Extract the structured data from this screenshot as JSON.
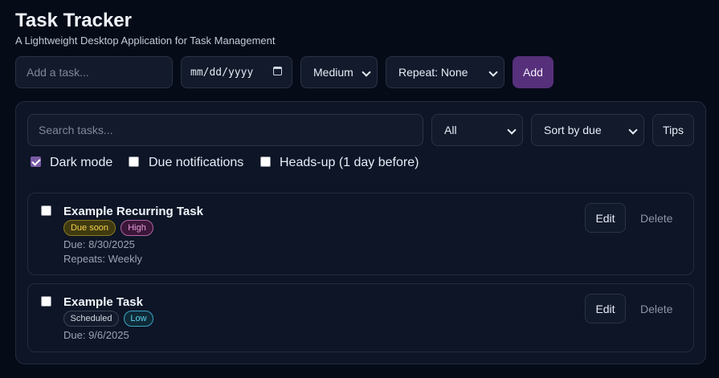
{
  "header": {
    "title": "Task Tracker",
    "subtitle": "A Lightweight Desktop Application for Task Management"
  },
  "add_form": {
    "task_placeholder": "Add a task...",
    "date_placeholder": "mm/dd/yyyy",
    "priority": "Medium",
    "repeat": "Repeat: None",
    "add_label": "Add"
  },
  "toolbar": {
    "search_placeholder": "Search tasks...",
    "filter": "All",
    "sort": "Sort by due",
    "tips_label": "Tips"
  },
  "toggles": [
    {
      "label": "Dark mode",
      "checked": true
    },
    {
      "label": "Due notifications",
      "checked": false
    },
    {
      "label": "Heads-up (1 day before)",
      "checked": false
    }
  ],
  "tasks": [
    {
      "title": "Example Recurring Task",
      "badges": [
        "Due soon",
        "High"
      ],
      "due": "Due: 8/30/2025",
      "repeats": "Repeats: Weekly",
      "edit_label": "Edit",
      "delete_label": "Delete",
      "checked": false
    },
    {
      "title": "Example Task",
      "badges": [
        "Scheduled",
        "Low"
      ],
      "due": "Due: 9/6/2025",
      "edit_label": "Edit",
      "delete_label": "Delete",
      "checked": false
    }
  ],
  "colors": {
    "background": "#060b18",
    "accent": "#56307a",
    "due_soon": "#f5d24b",
    "high": "#e79bd9",
    "low": "#5fd0ee"
  }
}
